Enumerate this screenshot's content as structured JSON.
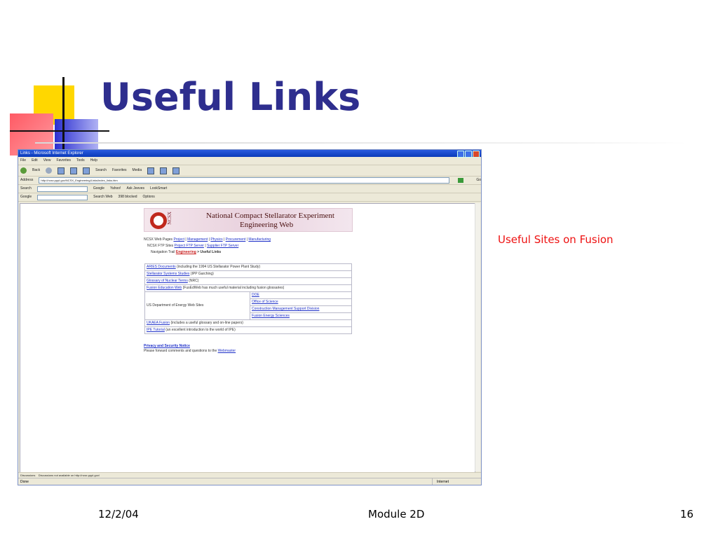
{
  "slide": {
    "title": "Useful Links",
    "side_note": "Useful Sites on Fusion",
    "footer": {
      "date": "12/2/04",
      "module": "Module 2D",
      "page_number": "16"
    },
    "colors": {
      "title": "#2e2e8e",
      "note": "#ee1111"
    }
  },
  "browser": {
    "window_title": "Links - Microsoft Internet Explorer",
    "menu": [
      "File",
      "Edit",
      "View",
      "Favorites",
      "Tools",
      "Help"
    ],
    "toolbar": [
      "Back",
      "Search",
      "Favorites",
      "Media"
    ],
    "address_label": "Address",
    "address_value": "http://ncsx.pppl.gov/NCSX_Engineering/Links/index_links.htm",
    "go_label": "Go",
    "search_bar": {
      "label": "Search",
      "items": [
        "Google",
        "Yahoo!",
        "Ask Jeeves",
        "LookSmart"
      ]
    },
    "google_bar": {
      "label": "Google",
      "items": [
        "Search Web",
        "398 blocked",
        "Options"
      ]
    },
    "discussions": {
      "label": "Discussions",
      "message": "Discussions not available on http://ncsx.pppl.gov/"
    },
    "status": {
      "left": "Done",
      "right": "Internet"
    },
    "page": {
      "banner": {
        "logo_text": "NCSX",
        "title_line1": "National Compact Stellarator Experiment",
        "title_line2": "Engineering Web"
      },
      "nav": {
        "web_pages_label": "NCSX Web Pages",
        "web_pages_links": [
          "Project",
          "Management",
          "Physics",
          "Procurement",
          "Manufacturing"
        ],
        "ftp_label": "NCSX FTP Sites",
        "ftp_links": [
          "Project FTP Server",
          "Supplier FTP Server"
        ],
        "trail_label": "Navigation Trail",
        "trail_link": "Engineering",
        "trail_current": "> Useful Links"
      },
      "links_table": {
        "aries": {
          "link": "ARIES Documents",
          "desc": " (including the 1994 US Stellarator Power Plant Study)"
        },
        "stellarator": {
          "link": "Stellarator Systems Studies",
          "desc": " (IPP Garching)"
        },
        "glossary": {
          "link": "Glossary of Nuclear Terms",
          "desc": " (NRC)"
        },
        "fusion_ed": {
          "link": "Fusion Education Web",
          "desc": " (FusEdWeb has much useful material including fusion glossaries)"
        },
        "doe": {
          "label": "US Department of Energy Web Sites",
          "links": [
            "DOE",
            "Office of Science",
            "Construction Management Support Division",
            "Fusion Energy Sciences"
          ]
        },
        "ukaea": {
          "link": "UKAEA Fusion",
          "desc": " (includes a useful glossary and on-line papers)"
        },
        "ipe": {
          "link": "IPE Tutorial",
          "desc": " (an excellent introduction to the world of IPE)"
        }
      },
      "privacy": "Privacy and Security Notice",
      "forward_text": "Please forward comments and questions to the ",
      "webmaster": "Webmaster"
    }
  }
}
